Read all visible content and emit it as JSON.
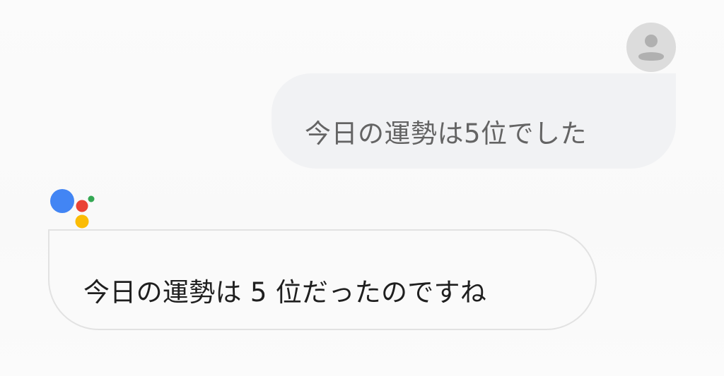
{
  "conversation": {
    "user_message": "今日の運勢は5位でした",
    "assistant_reply": "今日の運勢は 5 位だったのですね"
  },
  "icons": {
    "user_avatar": "person-icon",
    "assistant_logo": "google-assistant-dots-icon"
  },
  "colors": {
    "user_bubble": "#f1f2f4",
    "assistant_bubble_border": "#e2e2e2",
    "avatar_bg": "#dcdcdc",
    "assistant_blue": "#4285f4",
    "assistant_red": "#ea4335",
    "assistant_yellow": "#fbbc05",
    "assistant_green": "#34a853"
  }
}
